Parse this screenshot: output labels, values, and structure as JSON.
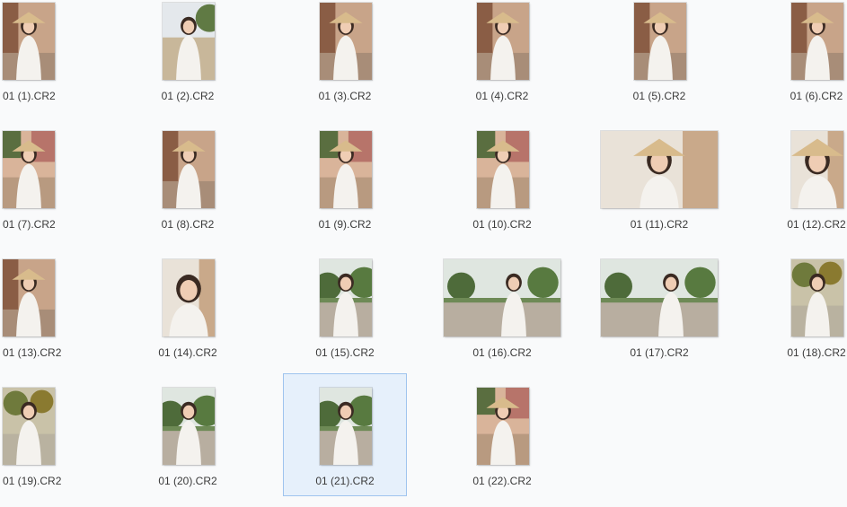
{
  "files": [
    {
      "name": "01 (1).CR2",
      "orientation": "portrait",
      "scene": "hat-sit"
    },
    {
      "name": "01 (2).CR2",
      "orientation": "portrait",
      "scene": "field"
    },
    {
      "name": "01 (3).CR2",
      "orientation": "portrait",
      "scene": "hat"
    },
    {
      "name": "01 (4).CR2",
      "orientation": "portrait",
      "scene": "hat-sit"
    },
    {
      "name": "01 (5).CR2",
      "orientation": "portrait",
      "scene": "hat-sit"
    },
    {
      "name": "01 (6).CR2",
      "orientation": "portrait",
      "scene": "hat-sit"
    },
    {
      "name": "01 (7).CR2",
      "orientation": "portrait",
      "scene": "hat-building"
    },
    {
      "name": "01 (8).CR2",
      "orientation": "portrait",
      "scene": "hat"
    },
    {
      "name": "01 (9).CR2",
      "orientation": "portrait",
      "scene": "hat-building"
    },
    {
      "name": "01 (10).CR2",
      "orientation": "portrait",
      "scene": "hat-building"
    },
    {
      "name": "01 (11).CR2",
      "orientation": "landscape",
      "scene": "closeup-hat"
    },
    {
      "name": "01 (12).CR2",
      "orientation": "portrait",
      "scene": "closeup-hat"
    },
    {
      "name": "01 (13).CR2",
      "orientation": "portrait",
      "scene": "hat"
    },
    {
      "name": "01 (14).CR2",
      "orientation": "portrait",
      "scene": "closeup"
    },
    {
      "name": "01 (15).CR2",
      "orientation": "portrait",
      "scene": "trees"
    },
    {
      "name": "01 (16).CR2",
      "orientation": "landscape",
      "scene": "park"
    },
    {
      "name": "01 (17).CR2",
      "orientation": "landscape",
      "scene": "park"
    },
    {
      "name": "01 (18).CR2",
      "orientation": "portrait",
      "scene": "flowers"
    },
    {
      "name": "01 (19).CR2",
      "orientation": "portrait",
      "scene": "flowers"
    },
    {
      "name": "01 (20).CR2",
      "orientation": "portrait",
      "scene": "trees"
    },
    {
      "name": "01 (21).CR2",
      "orientation": "portrait",
      "scene": "trees",
      "selected": true
    },
    {
      "name": "01 (22).CR2",
      "orientation": "portrait",
      "scene": "hat-building"
    }
  ]
}
